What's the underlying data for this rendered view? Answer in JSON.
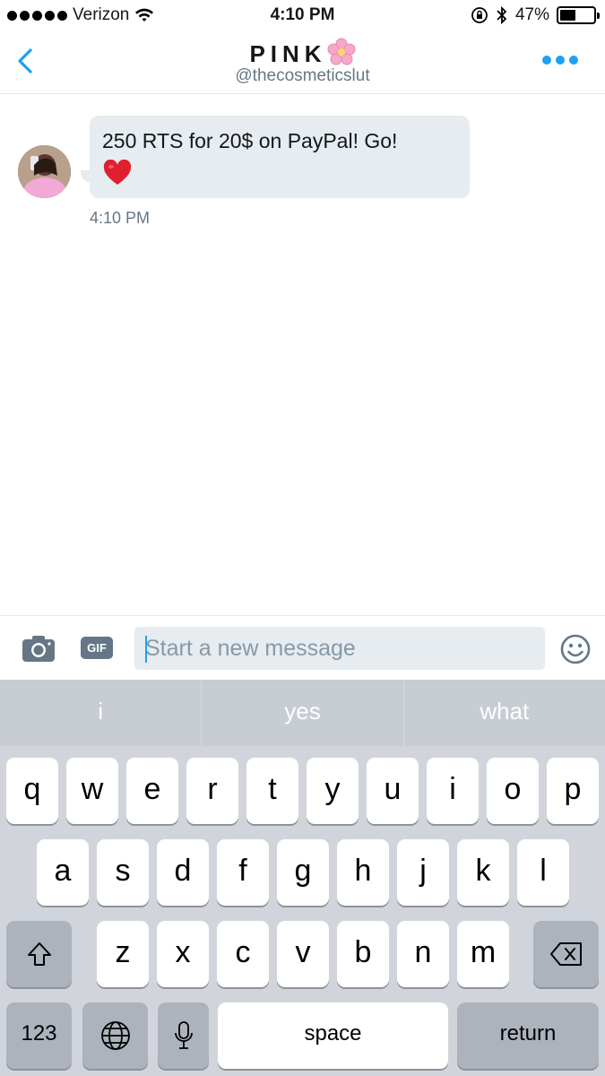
{
  "status_bar": {
    "carrier": "Verizon",
    "time": "4:10 PM",
    "battery": "47%",
    "battery_level": 0.47
  },
  "header": {
    "title": "PINK",
    "handle": "@thecosmeticslut",
    "back_icon": "chevron-left-icon",
    "more_icon": "more-dots-icon",
    "accent_color": "#1da1f2"
  },
  "messages": [
    {
      "text": "250 RTS for 20$ on PayPal! Go!",
      "emoji": "red-heart",
      "time": "4:10 PM"
    }
  ],
  "composer": {
    "placeholder": "Start a new message",
    "gif_label": "GIF",
    "camera_icon": "camera-icon",
    "emoji_icon": "smiley-icon"
  },
  "keyboard": {
    "predictions": [
      "i",
      "yes",
      "what"
    ],
    "row1": [
      "q",
      "w",
      "e",
      "r",
      "t",
      "y",
      "u",
      "i",
      "o",
      "p"
    ],
    "row2": [
      "a",
      "s",
      "d",
      "f",
      "g",
      "h",
      "j",
      "k",
      "l"
    ],
    "row3": [
      "z",
      "x",
      "c",
      "v",
      "b",
      "n",
      "m"
    ],
    "numbers_label": "123",
    "space_label": "space",
    "return_label": "return"
  }
}
